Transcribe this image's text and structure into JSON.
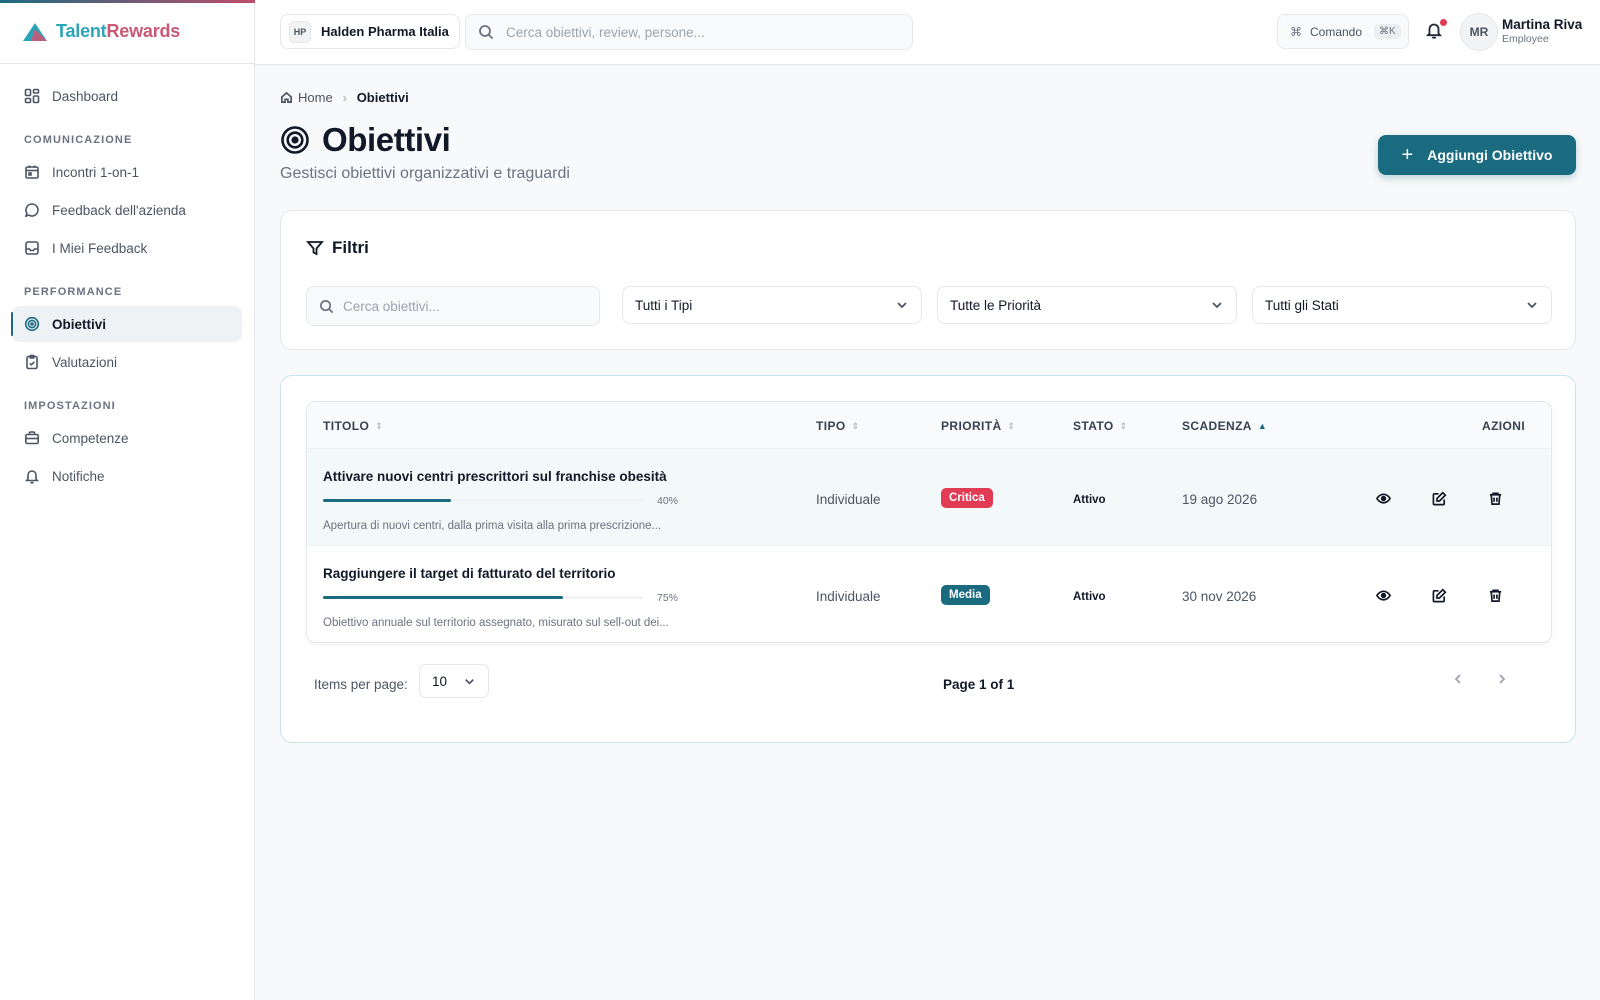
{
  "brand": {
    "part1": "Talent",
    "part2": "Rewards"
  },
  "sidebar": {
    "dashboard": "Dashboard",
    "sections": [
      {
        "title": "COMUNICAZIONE",
        "items": [
          "Incontri 1-on-1",
          "Feedback dell'azienda",
          "I Miei Feedback"
        ]
      },
      {
        "title": "PERFORMANCE",
        "items": [
          "Obiettivi",
          "Valutazioni"
        ]
      },
      {
        "title": "IMPOSTAZIONI",
        "items": [
          "Competenze",
          "Notifiche"
        ]
      }
    ],
    "active": "Obiettivi"
  },
  "topbar": {
    "org_initials": "HP",
    "org_name": "Halden Pharma Italia",
    "search_placeholder": "Cerca obiettivi, review, persone...",
    "command_label": "Comando",
    "command_kbd": "⌘K",
    "user_initials": "MR",
    "user_name": "Martina Riva",
    "user_role": "Employee",
    "has_notification": true
  },
  "breadcrumb": {
    "home": "Home",
    "current": "Obiettivi"
  },
  "page": {
    "title": "Obiettivi",
    "subtitle": "Gestisci obiettivi organizzativi e traguardi",
    "add_button": "Aggiungi Obiettivo"
  },
  "filters": {
    "title": "Filtri",
    "search_placeholder": "Cerca obiettivi...",
    "type_value": "Tutti i Tipi",
    "priority_value": "Tutte le Priorità",
    "status_value": "Tutti gli Stati"
  },
  "table": {
    "headers": {
      "title": "TITOLO",
      "type": "TIPO",
      "priority": "PRIORITÀ",
      "status": "STATO",
      "deadline": "SCADENZA",
      "actions": "AZIONI"
    },
    "sorted_by": "deadline",
    "rows": [
      {
        "title": "Attivare nuovi centri prescrittori sul franchise obesità",
        "progress": 40,
        "progress_label": "40%",
        "description": "Apertura di nuovi centri, dalla prima visita alla prima prescrizione...",
        "type": "Individuale",
        "priority": "Critica",
        "priority_color": "#e23b54",
        "status": "Attivo",
        "deadline": "19 ago 2026"
      },
      {
        "title": "Raggiungere il target di fatturato del territorio",
        "progress": 75,
        "progress_label": "75%",
        "description": "Obiettivo annuale sul territorio assegnato, misurato sul sell-out dei...",
        "type": "Individuale",
        "priority": "Media",
        "priority_color": "#1a6b80",
        "status": "Attivo",
        "deadline": "30 nov 2026"
      }
    ]
  },
  "pagination": {
    "items_per_page_label": "Items per page:",
    "items_per_page": "10",
    "page_info": "Page 1 of 1"
  },
  "colors": {
    "primary": "#1a6b80",
    "danger": "#e23b54",
    "brand_teal": "#2aa5b8",
    "brand_pink": "#c95a76"
  }
}
